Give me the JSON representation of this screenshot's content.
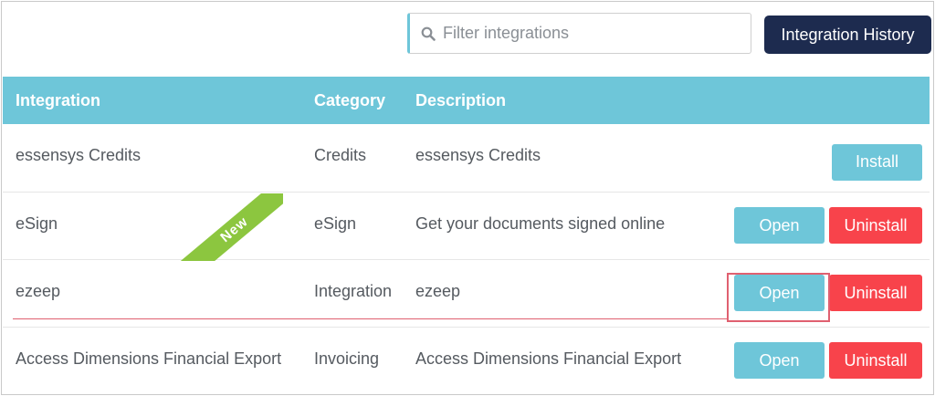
{
  "toolbar": {
    "search_placeholder": "Filter integrations",
    "history_button_label": "Integration History"
  },
  "table": {
    "headers": {
      "integration": "Integration",
      "category": "Category",
      "description": "Description"
    },
    "rows": [
      {
        "integration": "essensys Credits",
        "category": "Credits",
        "description": "essensys Credits",
        "primary_action": "Install",
        "secondary_action": ""
      },
      {
        "integration": "eSign",
        "category": "eSign",
        "description": "Get your documents signed online",
        "primary_action": "Open",
        "secondary_action": "Uninstall",
        "badge": "New"
      },
      {
        "integration": "ezeep",
        "category": "Integration",
        "description": "ezeep",
        "primary_action": "Open",
        "secondary_action": "Uninstall"
      },
      {
        "integration": "Access Dimensions Financial Export",
        "category": "Invoicing",
        "description": "Access Dimensions Financial Export",
        "primary_action": "Open",
        "secondary_action": "Uninstall"
      }
    ]
  },
  "colors": {
    "header_bg": "#6ec6d9",
    "primary_button": "#6ec6d9",
    "danger_button": "#f8434b",
    "history_button": "#1d2b4f",
    "badge": "#8cc63f",
    "annotation": "#e06070"
  },
  "icons": {
    "search": "search-icon"
  }
}
